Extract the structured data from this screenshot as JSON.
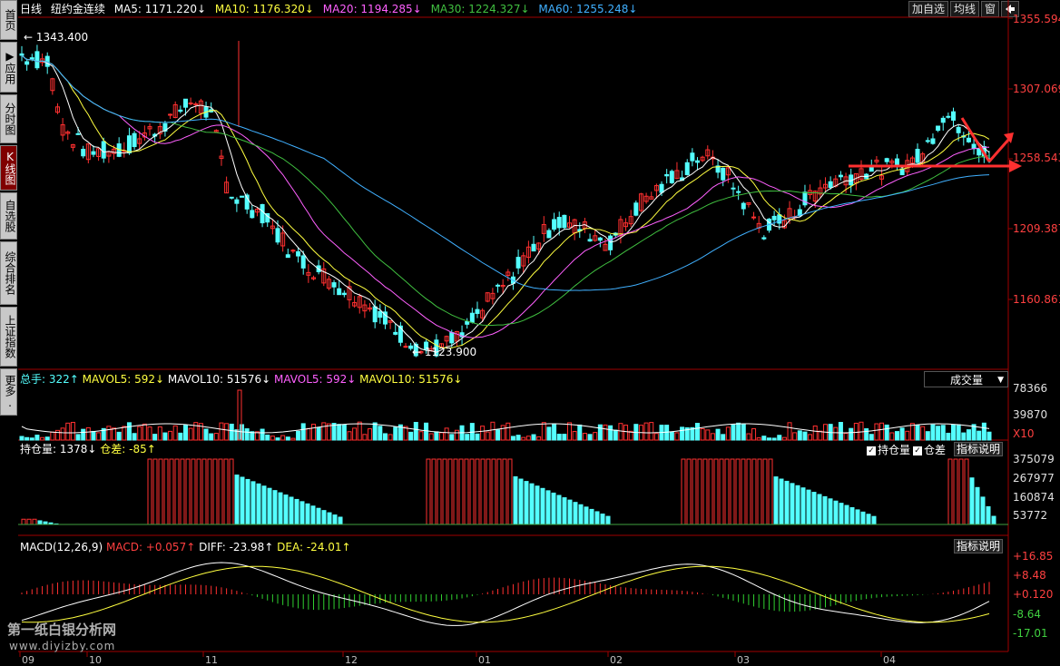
{
  "sidebar": [
    {
      "label": "首页",
      "active": false
    },
    {
      "label": "▶应用",
      "active": false
    },
    {
      "label": "分时图",
      "active": false
    },
    {
      "label": "K线图",
      "active": true
    },
    {
      "label": "自选股",
      "active": false
    },
    {
      "label": "综合排名",
      "active": false
    },
    {
      "label": "上证指数",
      "active": false
    },
    {
      "label": "更多.",
      "active": false
    }
  ],
  "header": {
    "period": "日线",
    "symbol": "纽约金连续",
    "ma5": "MA5: 1171.220↓",
    "ma10": "MA10: 1176.320↓",
    "ma20": "MA20: 1194.285↓",
    "ma30": "MA30: 1224.327↓",
    "ma60": "MA60: 1255.248↓"
  },
  "toolbar": {
    "add_fav": "加自选",
    "avg_line": "均线",
    "window": "窗",
    "exit_icon": "exit-icon"
  },
  "price_panel": {
    "high_label": "1343.400",
    "low_label": "1123.900",
    "ticks": [
      "1355.594",
      "1307.069",
      "1258.543",
      "1209.387",
      "1160.861"
    ]
  },
  "volume_panel": {
    "total": "总手: 322↑",
    "mavol5": "MAVOL5: 592↓",
    "mavol10": "MAVOL10: 51576↓",
    "mavol5b": "MAVOL5: 592↓",
    "mavol10b": "MAVOL10: 51576↓",
    "selector": "成交量",
    "ticks": [
      "78366",
      "39870",
      "X10"
    ]
  },
  "oi_panel": {
    "oi": "持仓量: 1378↓",
    "diff": "仓差: -85↑",
    "chk_oi": "持仓量",
    "chk_diff": "仓差",
    "help": "指标说明",
    "ticks": [
      "375079",
      "267977",
      "160874",
      "53772"
    ]
  },
  "macd_panel": {
    "name": "MACD(12,26,9)",
    "macd": "MACD: +0.057↑",
    "diff": "DIFF: -23.98↑",
    "dea": "DEA: -24.01↑",
    "help": "指标说明",
    "ticks": [
      "+16.85",
      "+8.48",
      "+0.120",
      "-8.64",
      "-17.01"
    ]
  },
  "x_axis": [
    "09",
    "10",
    "11",
    "12",
    "01",
    "02",
    "03",
    "04"
  ],
  "watermark": {
    "title": "第一纸白银分析网",
    "url": "www.diyizby.com"
  },
  "colors": {
    "up": "#ff3030",
    "down": "#54ffff",
    "ma5": "#ffffff",
    "ma10": "#ffff40",
    "ma20": "#ff60ff",
    "ma30": "#40c040",
    "ma60": "#40b0ff",
    "annotation": "#ff3030"
  }
}
